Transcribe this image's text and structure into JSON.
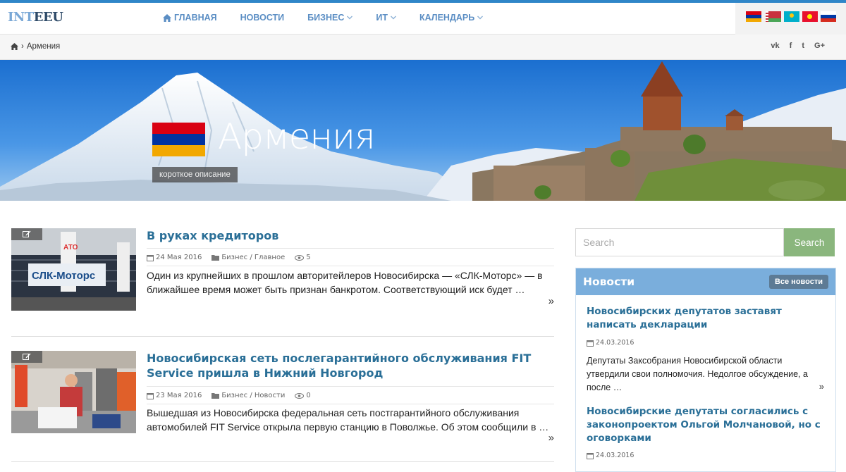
{
  "logo": {
    "part1": "INT",
    "part2": "EEU"
  },
  "nav": [
    {
      "label": "Главная",
      "icon": "home-icon",
      "dropdown": false
    },
    {
      "label": "Новости",
      "dropdown": false
    },
    {
      "label": "Бизнес",
      "dropdown": true
    },
    {
      "label": "ИТ",
      "dropdown": true
    },
    {
      "label": "Календарь",
      "dropdown": true
    }
  ],
  "languages": [
    "Армения",
    "Беларусь",
    "Казахстан",
    "Кыргызстан",
    "Россия"
  ],
  "breadcrumb": {
    "current": "Армения"
  },
  "social": [
    "vk",
    "f",
    "t",
    "G+"
  ],
  "hero": {
    "title": "Армения",
    "subtitle": "короткое описание"
  },
  "articles": [
    {
      "title": "В руках кредиторов",
      "date": "24 Мая 2016",
      "category": "Бизнес / Главное",
      "views": "5",
      "text": "Один из крупнейших в прошлом авторитейлеров Новосибирска — «СЛК-Моторс» — в ближайшее время может быть признан банкротом. Соответствующий иск будет …",
      "thumb_text": "СЛК-Моторс"
    },
    {
      "title": "Новосибирская сеть послегарантийного обслуживания FIT Service пришла в Нижний Новгород",
      "date": "23 Мая 2016",
      "category": "Бизнес / Новости",
      "views": "0",
      "text": "Вышедшая из Новосибирска федеральная сеть постгарантийного обслуживания автомобилей FIT Service открыла первую станцию в Поволжье. Об этом сообщили в …"
    }
  ],
  "search": {
    "placeholder": "Search",
    "button": "Search"
  },
  "news": {
    "heading": "Новости",
    "all_label": "Все новости",
    "items": [
      {
        "title": "Новосибирских депутатов заставят написать декларации",
        "date": "24.03.2016",
        "text": "Депутаты Заксобрания Новосибирской области утвердили свои полномочия. Недолгое обсуждение, а после …"
      },
      {
        "title": "Новосибирские депутаты согласились с законопроектом Ольгой Молчановой, но с оговорками",
        "date": "24.03.2016"
      }
    ]
  },
  "colors": {
    "accent": "#2a6f97",
    "nav": "#5b8ec4",
    "search_button": "#8ab67d",
    "news_header": "#7aaedc"
  }
}
